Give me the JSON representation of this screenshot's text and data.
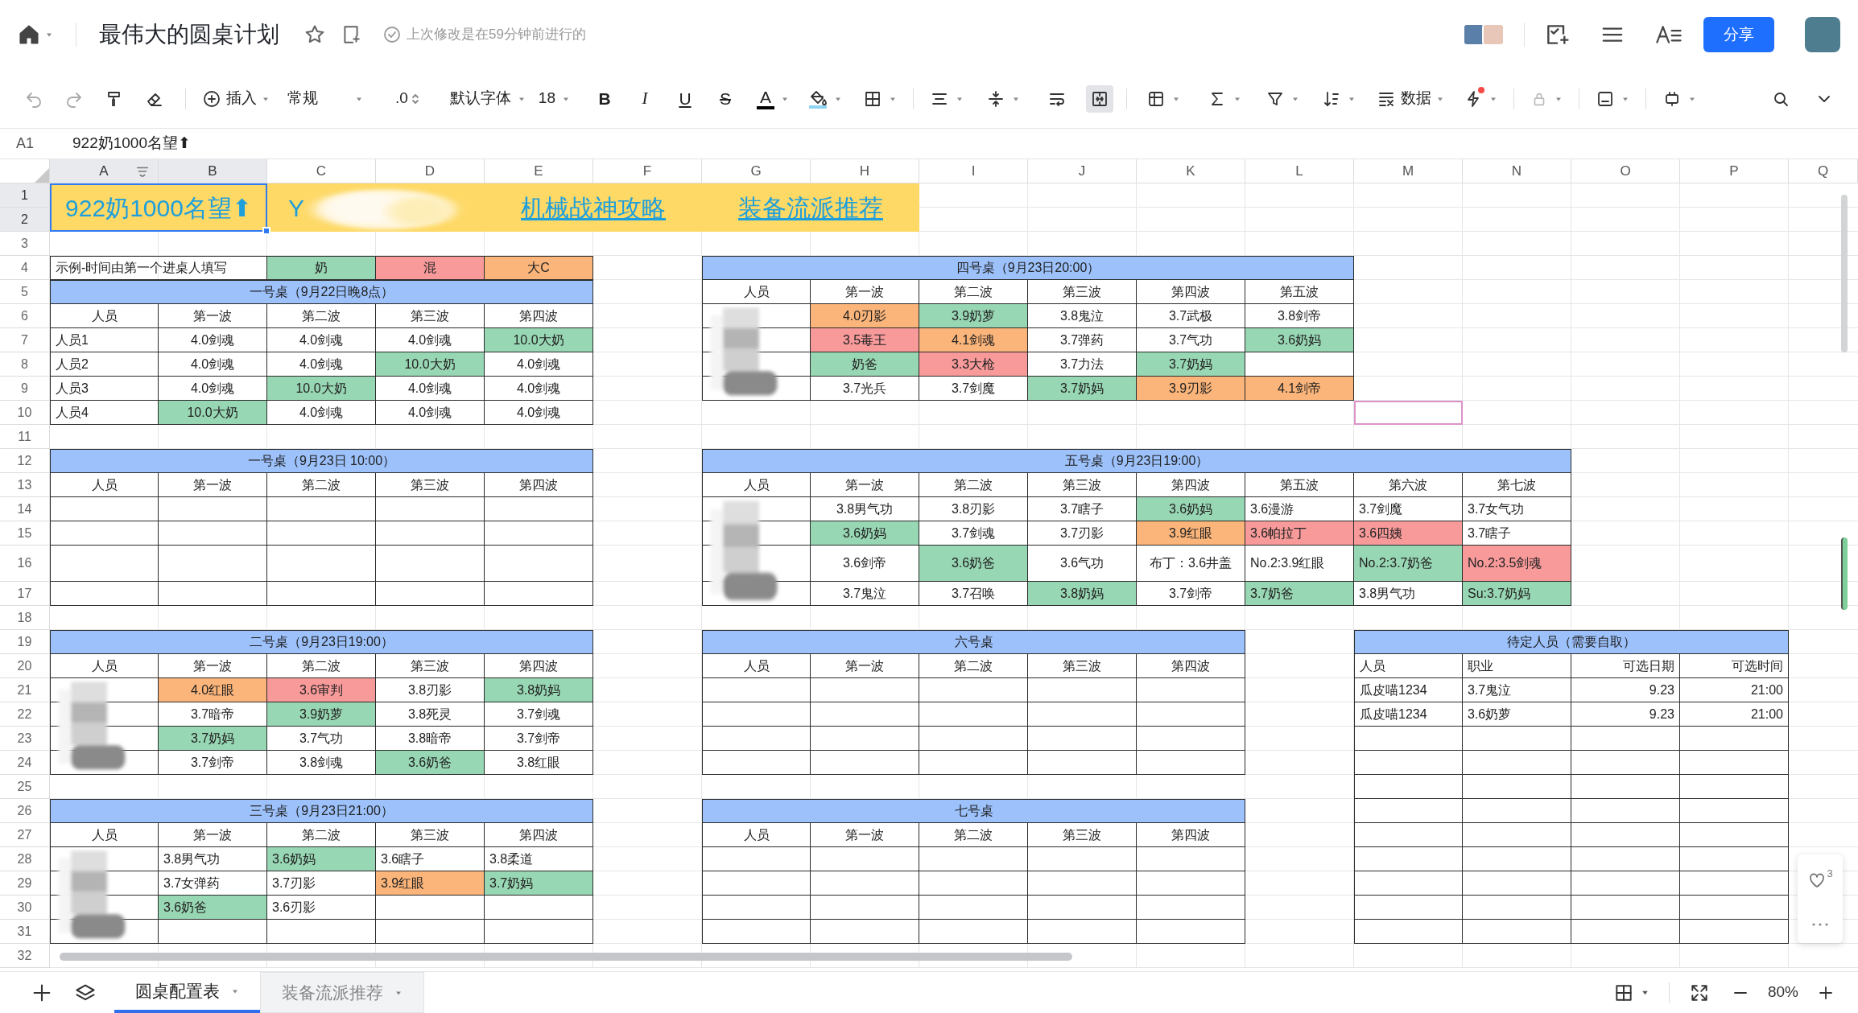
{
  "header": {
    "title": "最伟大的圆桌计划",
    "last_saved": "上次修改是在59分钟前进行的",
    "share_button": "分享"
  },
  "toolbar": {
    "insert": "插入",
    "number_format": "常规",
    "decimal": ".0",
    "font": "默认字体",
    "font_size": "18",
    "bold": "B",
    "italic": "I",
    "underline": "U",
    "strike": "S",
    "font_color": "A",
    "data": "数据",
    "merge_selected": true
  },
  "formula_bar": {
    "cell": "A1",
    "value": "922奶1000名望⬆"
  },
  "columns": [
    {
      "label": "A",
      "selected": true
    },
    {
      "label": "B",
      "selected": true
    },
    {
      "label": "C",
      "selected": false
    },
    {
      "label": "D",
      "selected": false
    },
    {
      "label": "E",
      "selected": false
    },
    {
      "label": "F",
      "selected": false
    },
    {
      "label": "G",
      "selected": false
    },
    {
      "label": "H",
      "selected": false
    },
    {
      "label": "I",
      "selected": false
    },
    {
      "label": "J",
      "selected": false
    },
    {
      "label": "K",
      "selected": false
    },
    {
      "label": "L",
      "selected": false
    },
    {
      "label": "M",
      "selected": false
    },
    {
      "label": "N",
      "selected": false
    },
    {
      "label": "O",
      "selected": false
    },
    {
      "label": "P",
      "selected": false
    },
    {
      "label": "Q",
      "selected": false
    }
  ],
  "rows": [
    {
      "label": "1",
      "selected": true
    },
    {
      "label": "2",
      "selected": true
    },
    {
      "label": "3",
      "selected": false
    },
    {
      "label": "4",
      "selected": false
    },
    {
      "label": "5",
      "selected": false
    },
    {
      "label": "6",
      "selected": false
    },
    {
      "label": "7",
      "selected": false
    },
    {
      "label": "8",
      "selected": false
    },
    {
      "label": "9",
      "selected": false
    },
    {
      "label": "10",
      "selected": false
    },
    {
      "label": "11",
      "selected": false
    },
    {
      "label": "12",
      "selected": false
    },
    {
      "label": "13",
      "selected": false
    },
    {
      "label": "14",
      "selected": false
    },
    {
      "label": "15",
      "selected": false
    },
    {
      "label": "16",
      "selected": false
    },
    {
      "label": "17",
      "selected": false
    },
    {
      "label": "18",
      "selected": false
    },
    {
      "label": "19",
      "selected": false
    },
    {
      "label": "20",
      "selected": false
    },
    {
      "label": "21",
      "selected": false
    },
    {
      "label": "22",
      "selected": false
    },
    {
      "label": "23",
      "selected": false
    },
    {
      "label": "24",
      "selected": false
    },
    {
      "label": "25",
      "selected": false
    },
    {
      "label": "26",
      "selected": false
    },
    {
      "label": "27",
      "selected": false
    },
    {
      "label": "28",
      "selected": false
    },
    {
      "label": "29",
      "selected": false
    },
    {
      "label": "30",
      "selected": false
    },
    {
      "label": "31",
      "selected": false
    },
    {
      "label": "32",
      "selected": false
    }
  ],
  "banner": [
    {
      "text": "922奶1000名望⬆",
      "kind": "title"
    },
    {
      "text": "Y",
      "kind": "blurred"
    },
    {
      "text": "机械战神攻略",
      "kind": "link"
    },
    {
      "text": "装备流派推荐",
      "kind": "link"
    }
  ],
  "legend": {
    "note": "示例-时间由第一个进桌人填写",
    "items": [
      {
        "label": "奶",
        "color": "#98d7b4"
      },
      {
        "label": "混",
        "color": "#f89a9a"
      },
      {
        "label": "大C",
        "color": "#fbb57a"
      }
    ]
  },
  "tables": [
    {
      "title": "一号桌（9月22日晚8点）",
      "headers": [
        "人员",
        "第一波",
        "第二波",
        "第三波",
        "第四波"
      ],
      "names_blurred": false,
      "rows": [
        [
          {
            "text": "人员1"
          },
          {
            "text": "4.0剑魂"
          },
          {
            "text": "4.0剑魂"
          },
          {
            "text": "4.0剑魂"
          },
          {
            "text": "10.0大奶",
            "color": "#98d7b4"
          }
        ],
        [
          {
            "text": "人员2"
          },
          {
            "text": "4.0剑魂"
          },
          {
            "text": "4.0剑魂"
          },
          {
            "text": "10.0大奶",
            "color": "#98d7b4"
          },
          {
            "text": "4.0剑魂"
          }
        ],
        [
          {
            "text": "人员3"
          },
          {
            "text": "4.0剑魂"
          },
          {
            "text": "10.0大奶",
            "color": "#98d7b4"
          },
          {
            "text": "4.0剑魂"
          },
          {
            "text": "4.0剑魂"
          }
        ],
        [
          {
            "text": "人员4"
          },
          {
            "text": "10.0大奶",
            "color": "#98d7b4"
          },
          {
            "text": "4.0剑魂"
          },
          {
            "text": "4.0剑魂"
          },
          {
            "text": "4.0剑魂"
          }
        ]
      ]
    },
    {
      "title": "四号桌（9月23日20:00）",
      "headers": [
        "人员",
        "第一波",
        "第二波",
        "第三波",
        "第四波",
        "第五波"
      ],
      "names_blurred": true,
      "rows": [
        [
          null,
          {
            "text": "4.0刃影",
            "color": "#fbb57a"
          },
          {
            "text": "3.9奶萝",
            "color": "#98d7b4"
          },
          {
            "text": "3.8鬼泣"
          },
          {
            "text": "3.7武极"
          },
          {
            "text": "3.8剑帝"
          }
        ],
        [
          null,
          {
            "text": "3.5毒王",
            "color": "#f89a9a"
          },
          {
            "text": "4.1剑魂",
            "color": "#fbb57a"
          },
          {
            "text": "3.7弹药"
          },
          {
            "text": "3.7气功"
          },
          {
            "text": "3.6奶妈",
            "color": "#98d7b4"
          }
        ],
        [
          null,
          {
            "text": "奶爸",
            "color": "#98d7b4"
          },
          {
            "text": "3.3大枪",
            "color": "#f89a9a"
          },
          {
            "text": "3.7力法"
          },
          {
            "text": "3.7奶妈",
            "color": "#98d7b4"
          },
          null
        ],
        [
          null,
          {
            "text": "3.7光兵"
          },
          {
            "text": "3.7剑魔"
          },
          {
            "text": "3.7奶妈",
            "color": "#98d7b4"
          },
          {
            "text": "3.9刃影",
            "color": "#fbb57a"
          },
          {
            "text": "4.1剑帝",
            "color": "#fbb57a"
          }
        ]
      ]
    },
    {
      "title": "一号桌（9月23日 10:00）",
      "headers": [
        "人员",
        "第一波",
        "第二波",
        "第三波",
        "第四波"
      ],
      "names_blurred": false,
      "rows": [
        [
          null,
          null,
          null,
          null,
          null
        ],
        [
          null,
          null,
          null,
          null,
          null
        ],
        [
          null,
          null,
          null,
          null,
          null
        ],
        [
          null,
          null,
          null,
          null,
          null
        ]
      ]
    },
    {
      "title": "五号桌（9月23日19:00）",
      "headers": [
        "人员",
        "第一波",
        "第二波",
        "第三波",
        "第四波",
        "第五波",
        "第六波",
        "第七波"
      ],
      "names_blurred": true,
      "rows": [
        [
          null,
          {
            "text": "3.8男气功"
          },
          {
            "text": "3.8刃影"
          },
          {
            "text": "3.7瞎子"
          },
          {
            "text": "3.6奶妈",
            "color": "#98d7b4"
          },
          {
            "text": "3.6漫游"
          },
          {
            "text": "3.7剑魔"
          },
          {
            "text": "3.7女气功"
          }
        ],
        [
          null,
          {
            "text": "3.6奶妈",
            "color": "#98d7b4"
          },
          {
            "text": "3.7剑魂"
          },
          {
            "text": "3.7刃影"
          },
          {
            "text": "3.9红眼",
            "color": "#fbb57a"
          },
          {
            "text": "3.6帕拉丁",
            "color": "#f89a9a"
          },
          {
            "text": "3.6四姨",
            "color": "#f89a9a"
          },
          {
            "text": "3.7瞎子"
          }
        ],
        [
          null,
          {
            "text": "3.6剑帝"
          },
          {
            "text": "3.6奶爸",
            "color": "#98d7b4"
          },
          {
            "text": "3.6气功"
          },
          {
            "text": "布丁：3.6井盖"
          },
          {
            "text": "No.2:3.9红眼"
          },
          {
            "text": "No.2:3.7奶爸",
            "color": "#98d7b4"
          },
          {
            "text": "No.2:3.5剑魂",
            "color": "#f89a9a"
          }
        ],
        [
          null,
          {
            "text": "3.7鬼泣"
          },
          {
            "text": "3.7召唤"
          },
          {
            "text": "3.8奶妈",
            "color": "#98d7b4"
          },
          {
            "text": "3.7剑帝"
          },
          {
            "text": "3.7奶爸",
            "color": "#98d7b4"
          },
          {
            "text": "3.8男气功"
          },
          {
            "text": "Su:3.7奶妈",
            "color": "#98d7b4"
          }
        ]
      ]
    },
    {
      "title": "二号桌（9月23日19:00）",
      "headers": [
        "人员",
        "第一波",
        "第二波",
        "第三波",
        "第四波"
      ],
      "names_blurred": true,
      "rows": [
        [
          null,
          {
            "text": "4.0红眼",
            "color": "#fbb57a"
          },
          {
            "text": "3.6审判",
            "color": "#f89a9a"
          },
          {
            "text": "3.8刃影"
          },
          {
            "text": "3.8奶妈",
            "color": "#98d7b4"
          }
        ],
        [
          null,
          {
            "text": "3.7暗帝"
          },
          {
            "text": "3.9奶萝",
            "color": "#98d7b4"
          },
          {
            "text": "3.8死灵"
          },
          {
            "text": "3.7剑魂"
          }
        ],
        [
          null,
          {
            "text": "3.7奶妈",
            "color": "#98d7b4"
          },
          {
            "text": "3.7气功"
          },
          {
            "text": "3.8暗帝"
          },
          {
            "text": "3.7剑帝"
          }
        ],
        [
          null,
          {
            "text": "3.7剑帝"
          },
          {
            "text": "3.8剑魂"
          },
          {
            "text": "3.6奶爸",
            "color": "#98d7b4"
          },
          {
            "text": "3.8红眼"
          }
        ]
      ]
    },
    {
      "title": "六号桌",
      "headers": [
        "人员",
        "第一波",
        "第二波",
        "第三波",
        "第四波"
      ],
      "names_blurred": false,
      "rows": [
        [
          null,
          null,
          null,
          null,
          null
        ],
        [
          null,
          null,
          null,
          null,
          null
        ],
        [
          null,
          null,
          null,
          null,
          null
        ],
        [
          null,
          null,
          null,
          null,
          null
        ]
      ]
    },
    {
      "title": "待定人员（需要自取）",
      "headers": [
        "人员",
        "职业",
        "可选日期",
        "可选时间"
      ],
      "names_blurred": false,
      "rows": [
        [
          {
            "text": "瓜皮喵1234"
          },
          {
            "text": "3.7鬼泣"
          },
          {
            "text": "9.23"
          },
          {
            "text": "21:00"
          }
        ],
        [
          {
            "text": "瓜皮喵1234"
          },
          {
            "text": "3.6奶萝"
          },
          {
            "text": "9.23"
          },
          {
            "text": "21:00"
          }
        ],
        [
          null,
          null,
          null,
          null
        ],
        [
          null,
          null,
          null,
          null
        ],
        [
          null,
          null,
          null,
          null
        ],
        [
          null,
          null,
          null,
          null
        ],
        [
          null,
          null,
          null,
          null
        ],
        [
          null,
          null,
          null,
          null
        ],
        [
          null,
          null,
          null,
          null
        ],
        [
          null,
          null,
          null,
          null
        ],
        [
          null,
          null,
          null,
          null
        ]
      ]
    },
    {
      "title": "三号桌（9月23日21:00）",
      "headers": [
        "人员",
        "第一波",
        "第二波",
        "第三波",
        "第四波"
      ],
      "names_blurred": true,
      "rows": [
        [
          null,
          {
            "text": "3.8男气功"
          },
          {
            "text": "3.6奶妈",
            "color": "#98d7b4"
          },
          {
            "text": "3.6瞎子"
          },
          {
            "text": "3.8柔道"
          }
        ],
        [
          null,
          {
            "text": "3.7女弹药"
          },
          {
            "text": "3.7刃影"
          },
          {
            "text": "3.9红眼",
            "color": "#fbb57a"
          },
          {
            "text": "3.7奶妈",
            "color": "#98d7b4"
          }
        ],
        [
          null,
          {
            "text": "3.6奶爸",
            "color": "#98d7b4"
          },
          {
            "text": "3.6刃影"
          },
          null,
          null
        ],
        [
          null,
          null,
          null,
          null,
          null
        ]
      ]
    },
    {
      "title": "七号桌",
      "headers": [
        "人员",
        "第一波",
        "第二波",
        "第三波",
        "第四波"
      ],
      "names_blurred": false,
      "rows": [
        [
          null,
          null,
          null,
          null,
          null
        ],
        [
          null,
          null,
          null,
          null,
          null
        ],
        [
          null,
          null,
          null,
          null,
          null
        ],
        [
          null,
          null,
          null,
          null,
          null
        ]
      ]
    }
  ],
  "sheet_tabs": [
    {
      "label": "圆桌配置表",
      "selected": true
    },
    {
      "label": "装备流派推荐",
      "selected": false
    }
  ],
  "zoom_level": "80%",
  "likes": "3"
}
